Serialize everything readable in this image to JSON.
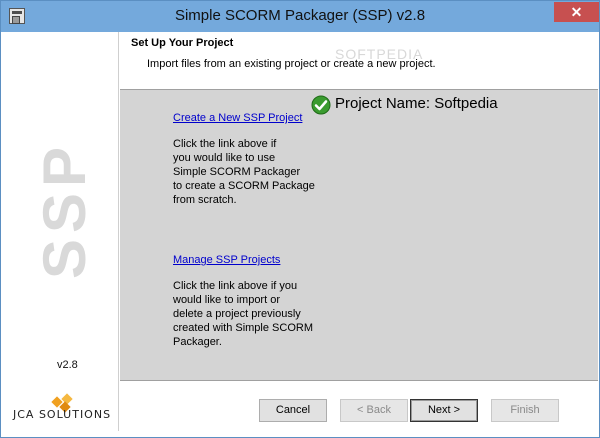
{
  "window": {
    "title": "Simple SCORM Packager (SSP) v2.8",
    "close_symbol": "✕"
  },
  "sidebar": {
    "watermark": "SSP",
    "version": "v2.8",
    "logo_text": "JCA SOLUTIONS"
  },
  "header": {
    "title": "Set Up Your Project",
    "subtitle": "Import files from an existing project or create a new project.",
    "watermark": "SOFTPEDIA"
  },
  "content": {
    "project_name": "Project Name: Softpedia",
    "create_link": "Create a New SSP Project",
    "create_desc": "Click the link above if\nyou would like to use\nSimple SCORM Packager\nto create a SCORM Package\nfrom scratch.",
    "manage_link": "Manage SSP Projects",
    "manage_desc": "Click the link above if you\nwould like to import or\ndelete a project previously\ncreated with Simple SCORM\nPackager."
  },
  "buttons": {
    "cancel": "Cancel",
    "back": "< Back",
    "next": "Next >",
    "finish": "Finish"
  },
  "icons": {
    "app": "app-icon",
    "close": "close-icon",
    "check": "green-check-icon"
  },
  "colors": {
    "titlebar": "#74a9dc",
    "close": "#c75050",
    "link": "#0000cc",
    "content_bg": "#d4d4d4"
  }
}
